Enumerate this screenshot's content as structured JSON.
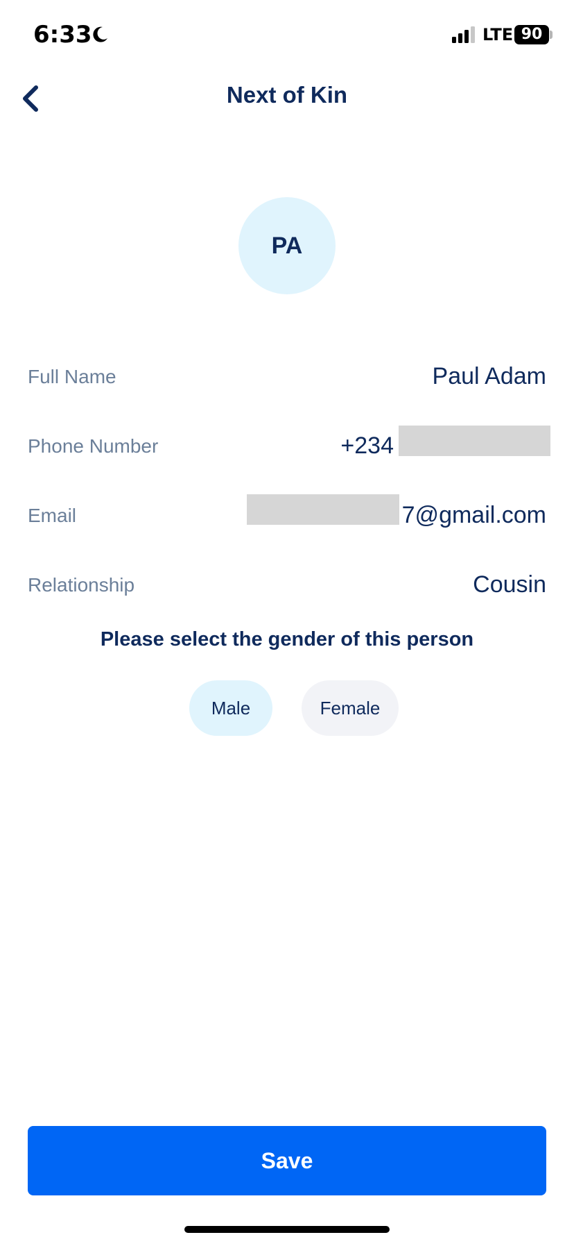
{
  "status_bar": {
    "time": "6:33",
    "network": "LTE",
    "battery": "90",
    "icons": [
      "moon-icon",
      "cellular-signal-icon",
      "battery-icon"
    ]
  },
  "header": {
    "title": "Next of Kin",
    "back_icon": "chevron-left-icon"
  },
  "avatar": {
    "initials": "PA",
    "background": "#e0f4fd"
  },
  "details": {
    "full_name": {
      "label": "Full Name",
      "value": "Paul Adam"
    },
    "phone": {
      "label": "Phone Number",
      "value": "+234"
    },
    "email": {
      "label": "Email",
      "value": "7@gmail.com"
    },
    "relationship": {
      "label": "Relationship",
      "value": "Cousin"
    }
  },
  "gender": {
    "prompt": "Please select the gender of this person",
    "options": [
      "Male",
      "Female"
    ]
  },
  "actions": {
    "save_label": "Save"
  },
  "colors": {
    "primary": "#0066f5",
    "text_dark": "#0f2a5c",
    "text_muted": "#6b7f99",
    "chip_selected": "#e0f4fd",
    "chip_default": "#f2f3f7",
    "redaction": "#d6d6d6"
  }
}
